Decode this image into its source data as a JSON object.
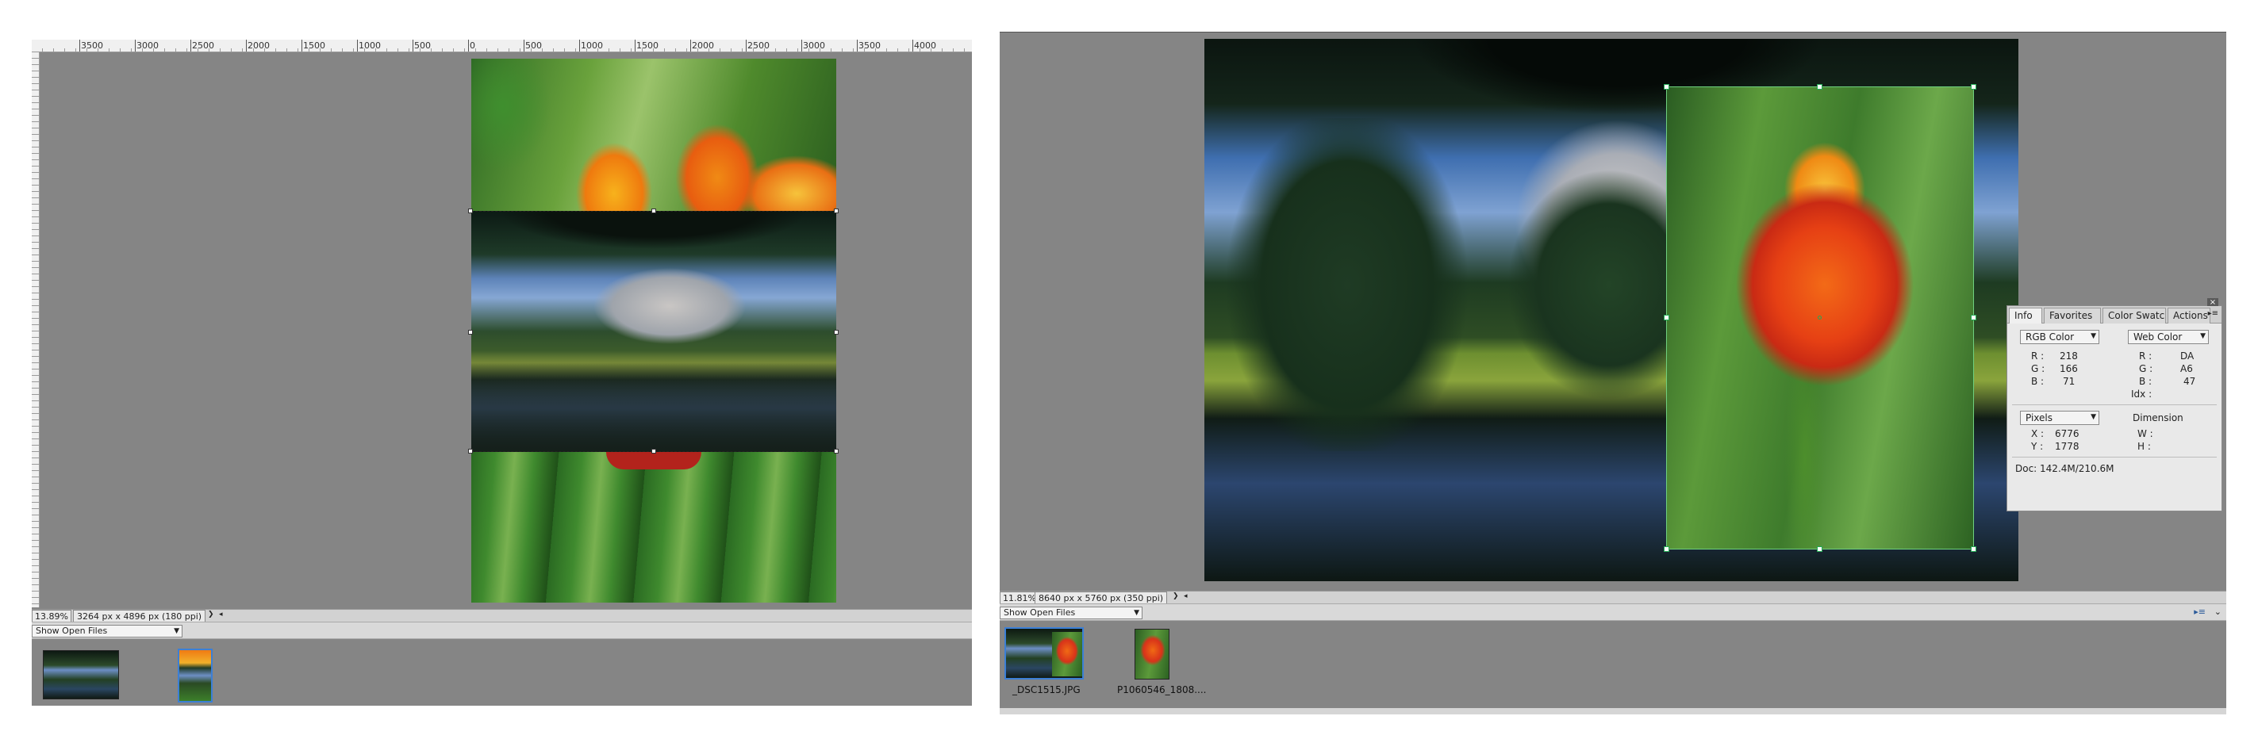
{
  "left": {
    "ruler_labels": [
      "3500",
      "3000",
      "2500",
      "2000",
      "1500",
      "1000",
      "500",
      "0",
      "500",
      "1000",
      "1500",
      "2000",
      "2500",
      "3000",
      "3500",
      "4000"
    ],
    "status": {
      "zoom": "13.89%",
      "doc_size": "3264 px x 4896 px (180 ppi)"
    },
    "bin_select": "Show Open Files"
  },
  "right": {
    "status": {
      "zoom": "11.81%",
      "doc_size": "8640 px x 5760 px (350 ppi)"
    },
    "bin_select": "Show Open Files",
    "thumbnails": [
      {
        "label": "_DSC1515.JPG"
      },
      {
        "label": "P1060546_1808...."
      }
    ]
  },
  "info_panel": {
    "tabs": [
      "Info",
      "Favorites",
      "Color Swatch",
      "Actions"
    ],
    "left_mode": "RGB Color",
    "right_mode": "Web Color",
    "rgb": {
      "r_label": "R :",
      "r": "218",
      "g_label": "G :",
      "g": "166",
      "b_label": "B :",
      "b": "71"
    },
    "web": {
      "r_label": "R :",
      "r": "DA",
      "g_label": "G :",
      "g": "A6",
      "b_label": "B :",
      "b": "47",
      "idx_label": "Idx :"
    },
    "unit": "Pixels",
    "dimension_label": "Dimension",
    "coords": {
      "x_label": "X :",
      "x": "6776",
      "y_label": "Y :",
      "y": "1778"
    },
    "dims": {
      "w_label": "W :",
      "h_label": "H :"
    },
    "doc": "Doc: 142.4M/210.6M"
  },
  "colors": {
    "canvas_bg": "#858585",
    "panel_bg": "#e9e9e9",
    "selection_handle": "#2aa855"
  }
}
